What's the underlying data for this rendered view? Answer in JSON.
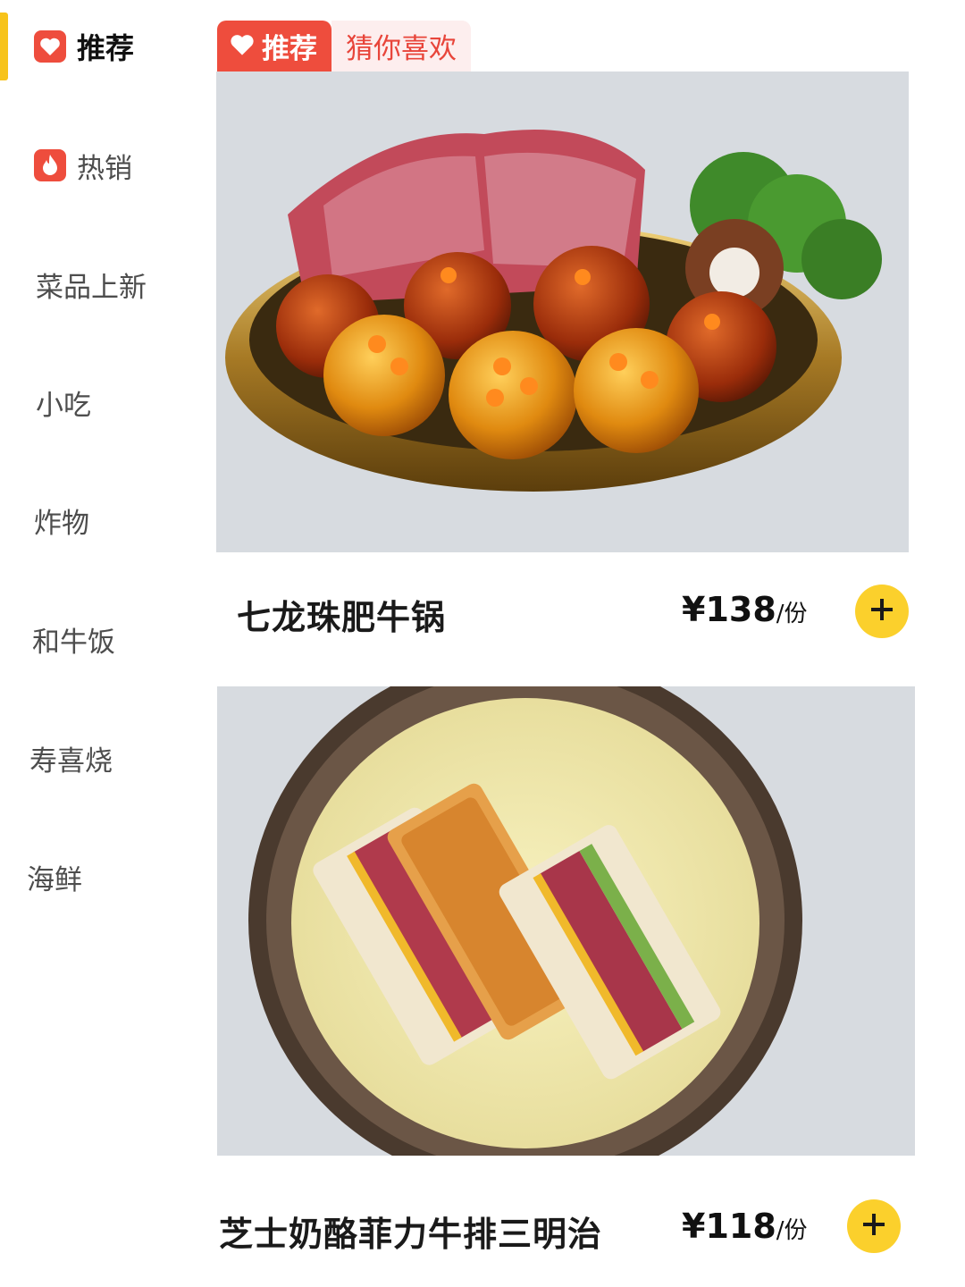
{
  "colors": {
    "accent": "#f7c31a",
    "tag_red": "#ee4d3d",
    "add_button": "#fbd02c"
  },
  "sidebar": {
    "items": [
      {
        "label": "推荐",
        "icon": "heart-icon",
        "active": true
      },
      {
        "label": "热销",
        "icon": "flame-icon",
        "active": false
      },
      {
        "label": "菜品上新",
        "active": false
      },
      {
        "label": "小吃",
        "active": false
      },
      {
        "label": "炸物",
        "active": false
      },
      {
        "label": "和牛饭",
        "active": false
      },
      {
        "label": "寿喜烧",
        "active": false
      },
      {
        "label": "海鲜",
        "active": false
      }
    ]
  },
  "tabs": {
    "recommend": {
      "label": "推荐",
      "icon": "heart-icon"
    },
    "guess": {
      "label": "猜你喜欢"
    }
  },
  "products": [
    {
      "name": "七龙珠肥牛锅",
      "price": "¥138",
      "unit": "/份",
      "photo": "dragon-ball-beef-hotpot-photo",
      "add_icon": "plus-icon"
    },
    {
      "name": "芝士奶酪菲力牛排三明治",
      "price": "¥118",
      "unit": "/份",
      "photo": "cheese-fillet-steak-sandwich-photo",
      "add_icon": "plus-icon"
    }
  ]
}
